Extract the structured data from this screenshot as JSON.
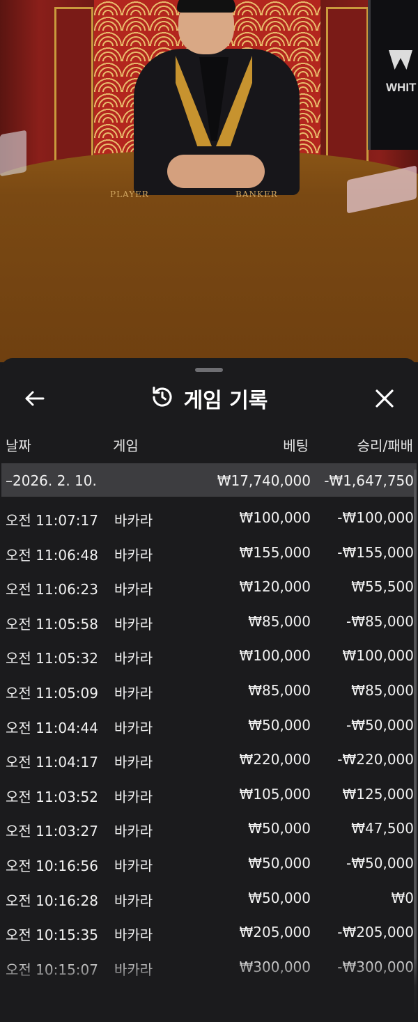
{
  "video": {
    "table_label_player": "PLAYER",
    "table_label_banker": "BANKER",
    "screen_text": "WHIT"
  },
  "sheet": {
    "title": "게임 기록",
    "icons": {
      "back": "back-arrow-icon",
      "history": "history-icon",
      "close": "close-icon"
    },
    "columns": {
      "date": "날짜",
      "game": "게임",
      "bet": "베팅",
      "result": "승리/패배"
    },
    "summary": {
      "date": "–2026. 2. 10.",
      "bet": "₩17,740,000",
      "result": "-₩1,647,750"
    },
    "rows": [
      {
        "time": "오전 11:07:17",
        "game": "바카라",
        "bet": "₩100,000",
        "result": "-₩100,000"
      },
      {
        "time": "오전 11:06:48",
        "game": "바카라",
        "bet": "₩155,000",
        "result": "-₩155,000"
      },
      {
        "time": "오전 11:06:23",
        "game": "바카라",
        "bet": "₩120,000",
        "result": "₩55,500"
      },
      {
        "time": "오전 11:05:58",
        "game": "바카라",
        "bet": "₩85,000",
        "result": "-₩85,000"
      },
      {
        "time": "오전 11:05:32",
        "game": "바카라",
        "bet": "₩100,000",
        "result": "₩100,000"
      },
      {
        "time": "오전 11:05:09",
        "game": "바카라",
        "bet": "₩85,000",
        "result": "₩85,000"
      },
      {
        "time": "오전 11:04:44",
        "game": "바카라",
        "bet": "₩50,000",
        "result": "-₩50,000"
      },
      {
        "time": "오전 11:04:17",
        "game": "바카라",
        "bet": "₩220,000",
        "result": "-₩220,000"
      },
      {
        "time": "오전 11:03:52",
        "game": "바카라",
        "bet": "₩105,000",
        "result": "₩125,000"
      },
      {
        "time": "오전 11:03:27",
        "game": "바카라",
        "bet": "₩50,000",
        "result": "₩47,500"
      },
      {
        "time": "오전 10:16:56",
        "game": "바카라",
        "bet": "₩50,000",
        "result": "-₩50,000"
      },
      {
        "time": "오전 10:16:28",
        "game": "바카라",
        "bet": "₩50,000",
        "result": "₩0"
      },
      {
        "time": "오전 10:15:35",
        "game": "바카라",
        "bet": "₩205,000",
        "result": "-₩205,000"
      },
      {
        "time": "오전 10:15:07",
        "game": "바카라",
        "bet": "₩300,000",
        "result": "-₩300,000"
      }
    ]
  },
  "colors": {
    "sheet_bg": "#1b1b1d",
    "summary_bg": "#3d3d40",
    "text": "#f2f2f2"
  }
}
